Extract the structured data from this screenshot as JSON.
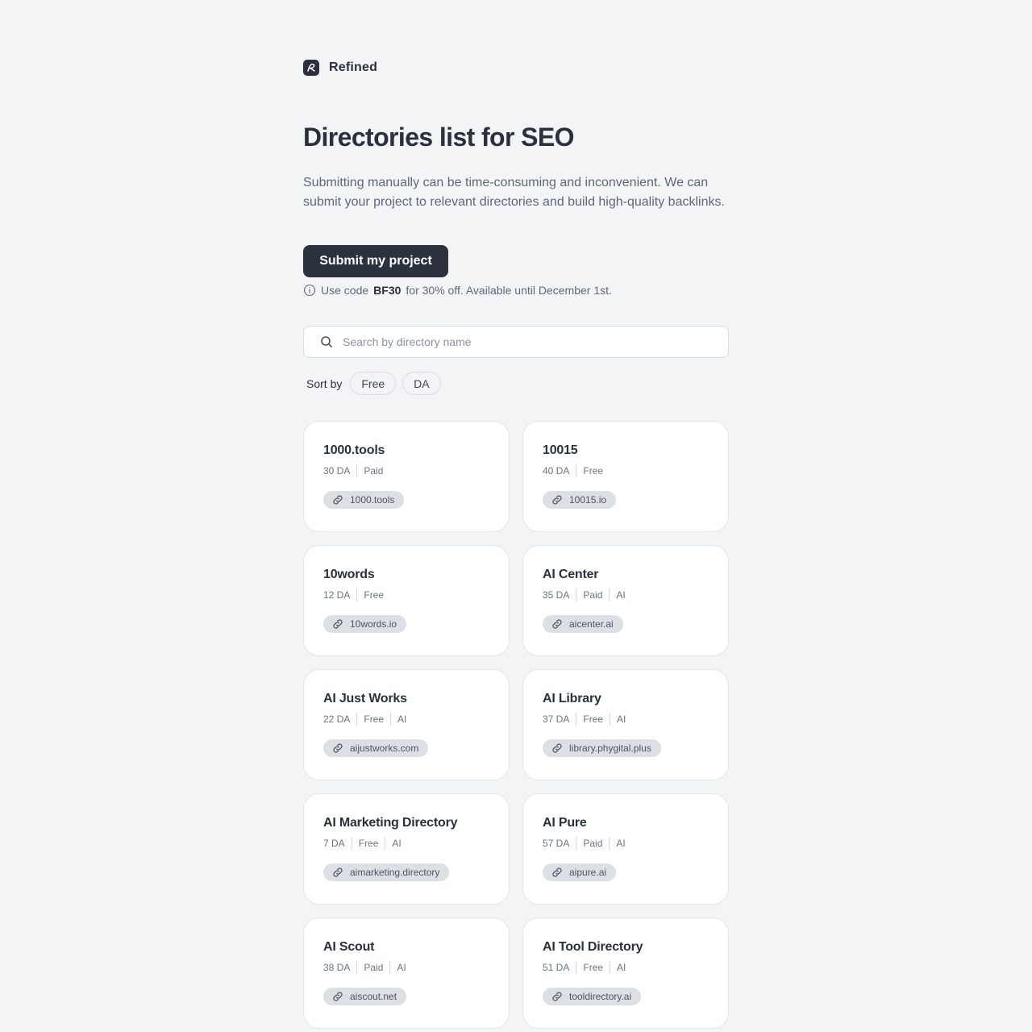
{
  "brand": {
    "name": "Refined",
    "logo_icon": "refined-logo-icon"
  },
  "hero": {
    "title": "Directories list for SEO",
    "description": "Submitting manually can be time-consuming and inconvenient. We can submit your project to relevant directories and build high-quality backlinks.",
    "cta_label": "Submit my project",
    "promo_prefix": "Use code",
    "promo_code": "BF30",
    "promo_suffix": "for 30% off. Available until December 1st."
  },
  "search": {
    "placeholder": "Search by directory name",
    "value": ""
  },
  "sort": {
    "label": "Sort by",
    "options": [
      "Free",
      "DA"
    ]
  },
  "colors": {
    "primary": "#2b323d",
    "background": "#f3f4f6",
    "chip": "#dcdfe4"
  },
  "directories": [
    {
      "name": "1000.tools",
      "da": "30 DA",
      "price": "Paid",
      "tag": "",
      "url": "1000.tools"
    },
    {
      "name": "10015",
      "da": "40 DA",
      "price": "Free",
      "tag": "",
      "url": "10015.io"
    },
    {
      "name": "10words",
      "da": "12 DA",
      "price": "Free",
      "tag": "",
      "url": "10words.io"
    },
    {
      "name": "AI Center",
      "da": "35 DA",
      "price": "Paid",
      "tag": "AI",
      "url": "aicenter.ai"
    },
    {
      "name": "AI Just Works",
      "da": "22 DA",
      "price": "Free",
      "tag": "AI",
      "url": "aijustworks.com"
    },
    {
      "name": "AI Library",
      "da": "37 DA",
      "price": "Free",
      "tag": "AI",
      "url": "library.phygital.plus"
    },
    {
      "name": "AI Marketing Directory",
      "da": "7 DA",
      "price": "Free",
      "tag": "AI",
      "url": "aimarketing.directory"
    },
    {
      "name": "AI Pure",
      "da": "57 DA",
      "price": "Paid",
      "tag": "AI",
      "url": "aipure.ai"
    },
    {
      "name": "AI Scout",
      "da": "38 DA",
      "price": "Paid",
      "tag": "AI",
      "url": "aiscout.net"
    },
    {
      "name": "AI Tool Directory",
      "da": "51 DA",
      "price": "Free",
      "tag": "AI",
      "url": "tooldirectory.ai"
    }
  ]
}
